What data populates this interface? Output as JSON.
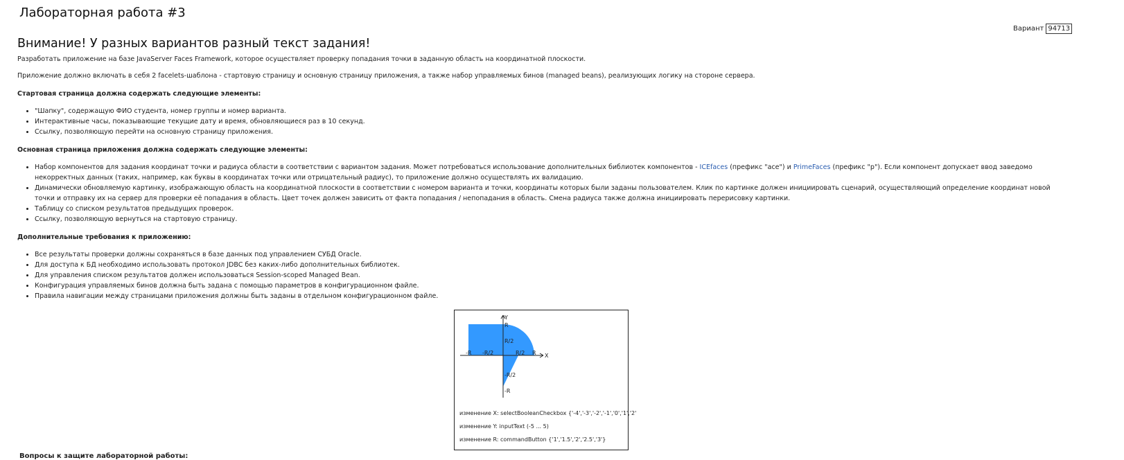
{
  "header": {
    "title": "Лабораторная работа #3",
    "variant_label": "Вариант",
    "variant_value": "94713"
  },
  "warning": "Внимание! У разных вариантов разный текст задания!",
  "intro": [
    "Разработать приложение на базе JavaServer Faces Framework, которое осуществляет проверку попадания точки в заданную область на координатной плоскости.",
    "Приложение должно включать в себя 2 facelets-шаблона - стартовую страницу и основную страницу приложения, а также набор управляемых бинов (managed beans), реализующих логику на стороне сервера."
  ],
  "start_page": {
    "heading": "Стартовая страница должна содержать следующие элементы:",
    "items": [
      "\"Шапку\", содержащую ФИО студента, номер группы и номер варианта.",
      "Интерактивные часы, показывающие текущие дату и время, обновляющиеся раз в 10 секунд.",
      "Ссылку, позволяющую перейти на основную страницу приложения."
    ]
  },
  "main_page": {
    "heading": "Основная страница приложения должна содержать следующие элементы:",
    "item1_part1": "Набор компонентов для задания координат точки и радиуса области в соответствии с вариантом задания. Может потребоваться использование дополнительных библиотек компонентов - ",
    "item1_link1": "ICEfaces",
    "item1_part2": " (префикс \"ace\") и ",
    "item1_link2": "PrimeFaces",
    "item1_part3": " (префикс \"p\"). Если компонент допускает ввод заведомо некорректных данных (таких, например, как буквы в координатах точки или отрицательный радиус), то приложение должно осуществлять их валидацию.",
    "items_rest": [
      "Динамически обновляемую картинку, изображающую область на координатной плоскости в соответствии с номером варианта и точки, координаты которых были заданы пользователем. Клик по картинке должен инициировать сценарий, осуществляющий определение координат новой точки и отправку их на сервер для проверки её попадания в область. Цвет точек должен зависить от факта попадания / непопадания в область. Смена радиуса также должна инициировать перерисовку картинки.",
      "Таблицу со списком результатов предыдущих проверок.",
      "Ссылку, позволяющую вернуться на стартовую страницу."
    ]
  },
  "additional": {
    "heading": "Дополнительные требования к приложению:",
    "items": [
      "Все результаты проверки должны сохраняться в базе данных под управлением СУБД Oracle.",
      "Для доступа к БД необходимо использовать протокол JDBC без каких-либо дополнительных библиотек.",
      "Для управления списком результатов должен использоваться Session-scoped Managed Bean.",
      "Конфигурация управляемых бинов должна быть задана с помощью параметров в конфигурационном файле.",
      "Правила навигации между страницами приложения должны быть заданы в отдельном конфигурационном файле."
    ]
  },
  "figure": {
    "axis_labels": {
      "y": "Y",
      "x": "X",
      "r_top": "R",
      "r2_top": "R/2",
      "neg_r": "-R",
      "neg_r2": "-R/2",
      "r2_right": "R/2",
      "r_right": "R",
      "neg_r2_bottom": "-R/2",
      "neg_r_bottom": "-R"
    },
    "area_color": "#3399ff",
    "captions": [
      "изменение X: selectBooleanCheckbox {'-4','-3','-2','-1','0','1','2'",
      "изменение Y: inputText (-5 ... 5)",
      "изменение R: commandButton {'1','1.5','2','2.5','3'}"
    ]
  },
  "questions_heading": "Вопросы к защите лабораторной работы:"
}
